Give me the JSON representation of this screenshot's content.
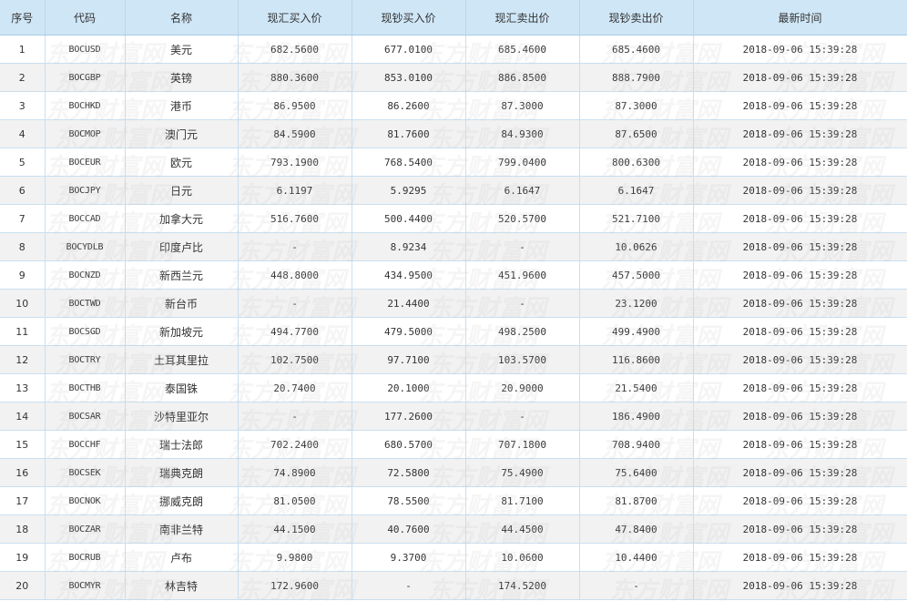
{
  "table": {
    "headers": [
      "序号",
      "代码",
      "名称",
      "现汇买入价",
      "现钞买入价",
      "现汇卖出价",
      "现钞卖出价",
      "最新时间"
    ],
    "rows": [
      {
        "index": "1",
        "code": "BOCUSD",
        "name": "美元",
        "spot_buy": "682.5600",
        "cash_buy": "677.0100",
        "spot_sell": "685.4600",
        "cash_sell": "685.4600",
        "time": "2018-09-06 15:39:28"
      },
      {
        "index": "2",
        "code": "BOCGBP",
        "name": "英镑",
        "spot_buy": "880.3600",
        "cash_buy": "853.0100",
        "spot_sell": "886.8500",
        "cash_sell": "888.7900",
        "time": "2018-09-06 15:39:28"
      },
      {
        "index": "3",
        "code": "BOCHKD",
        "name": "港币",
        "spot_buy": "86.9500",
        "cash_buy": "86.2600",
        "spot_sell": "87.3000",
        "cash_sell": "87.3000",
        "time": "2018-09-06 15:39:28"
      },
      {
        "index": "4",
        "code": "BOCMOP",
        "name": "澳门元",
        "spot_buy": "84.5900",
        "cash_buy": "81.7600",
        "spot_sell": "84.9300",
        "cash_sell": "87.6500",
        "time": "2018-09-06 15:39:28"
      },
      {
        "index": "5",
        "code": "BOCEUR",
        "name": "欧元",
        "spot_buy": "793.1900",
        "cash_buy": "768.5400",
        "spot_sell": "799.0400",
        "cash_sell": "800.6300",
        "time": "2018-09-06 15:39:28"
      },
      {
        "index": "6",
        "code": "BOCJPY",
        "name": "日元",
        "spot_buy": "6.1197",
        "cash_buy": "5.9295",
        "spot_sell": "6.1647",
        "cash_sell": "6.1647",
        "time": "2018-09-06 15:39:28"
      },
      {
        "index": "7",
        "code": "BOCCAD",
        "name": "加拿大元",
        "spot_buy": "516.7600",
        "cash_buy": "500.4400",
        "spot_sell": "520.5700",
        "cash_sell": "521.7100",
        "time": "2018-09-06 15:39:28"
      },
      {
        "index": "8",
        "code": "BOCYDLB",
        "name": "印度卢比",
        "spot_buy": "-",
        "cash_buy": "8.9234",
        "spot_sell": "-",
        "cash_sell": "10.0626",
        "time": "2018-09-06 15:39:28"
      },
      {
        "index": "9",
        "code": "BOCNZD",
        "name": "新西兰元",
        "spot_buy": "448.8000",
        "cash_buy": "434.9500",
        "spot_sell": "451.9600",
        "cash_sell": "457.5000",
        "time": "2018-09-06 15:39:28"
      },
      {
        "index": "10",
        "code": "BOCTWD",
        "name": "新台币",
        "spot_buy": "-",
        "cash_buy": "21.4400",
        "spot_sell": "-",
        "cash_sell": "23.1200",
        "time": "2018-09-06 15:39:28"
      },
      {
        "index": "11",
        "code": "BOCSGD",
        "name": "新加坡元",
        "spot_buy": "494.7700",
        "cash_buy": "479.5000",
        "spot_sell": "498.2500",
        "cash_sell": "499.4900",
        "time": "2018-09-06 15:39:28"
      },
      {
        "index": "12",
        "code": "BOCTRY",
        "name": "土耳其里拉",
        "spot_buy": "102.7500",
        "cash_buy": "97.7100",
        "spot_sell": "103.5700",
        "cash_sell": "116.8600",
        "time": "2018-09-06 15:39:28"
      },
      {
        "index": "13",
        "code": "BOCTHB",
        "name": "泰国铢",
        "spot_buy": "20.7400",
        "cash_buy": "20.1000",
        "spot_sell": "20.9000",
        "cash_sell": "21.5400",
        "time": "2018-09-06 15:39:28"
      },
      {
        "index": "14",
        "code": "BOCSAR",
        "name": "沙特里亚尔",
        "spot_buy": "-",
        "cash_buy": "177.2600",
        "spot_sell": "-",
        "cash_sell": "186.4900",
        "time": "2018-09-06 15:39:28"
      },
      {
        "index": "15",
        "code": "BOCCHF",
        "name": "瑞士法郎",
        "spot_buy": "702.2400",
        "cash_buy": "680.5700",
        "spot_sell": "707.1800",
        "cash_sell": "708.9400",
        "time": "2018-09-06 15:39:28"
      },
      {
        "index": "16",
        "code": "BOCSEK",
        "name": "瑞典克朗",
        "spot_buy": "74.8900",
        "cash_buy": "72.5800",
        "spot_sell": "75.4900",
        "cash_sell": "75.6400",
        "time": "2018-09-06 15:39:28"
      },
      {
        "index": "17",
        "code": "BOCNOK",
        "name": "挪威克朗",
        "spot_buy": "81.0500",
        "cash_buy": "78.5500",
        "spot_sell": "81.7100",
        "cash_sell": "81.8700",
        "time": "2018-09-06 15:39:28"
      },
      {
        "index": "18",
        "code": "BOCZAR",
        "name": "南非兰特",
        "spot_buy": "44.1500",
        "cash_buy": "40.7600",
        "spot_sell": "44.4500",
        "cash_sell": "47.8400",
        "time": "2018-09-06 15:39:28"
      },
      {
        "index": "19",
        "code": "BOCRUB",
        "name": "卢布",
        "spot_buy": "9.9800",
        "cash_buy": "9.3700",
        "spot_sell": "10.0600",
        "cash_sell": "10.4400",
        "time": "2018-09-06 15:39:28"
      },
      {
        "index": "20",
        "code": "BOCMYR",
        "name": "林吉特",
        "spot_buy": "172.9600",
        "cash_buy": "-",
        "spot_sell": "174.5200",
        "cash_sell": "-",
        "time": "2018-09-06 15:39:28"
      }
    ]
  },
  "watermark": {
    "text": "东方财富网",
    "color": "#c8c8c8"
  },
  "colors": {
    "header_bg": "#cfe6f6",
    "row_alt_bg": "#f2f2f2",
    "border": "#c9dff0",
    "text": "#333333"
  }
}
